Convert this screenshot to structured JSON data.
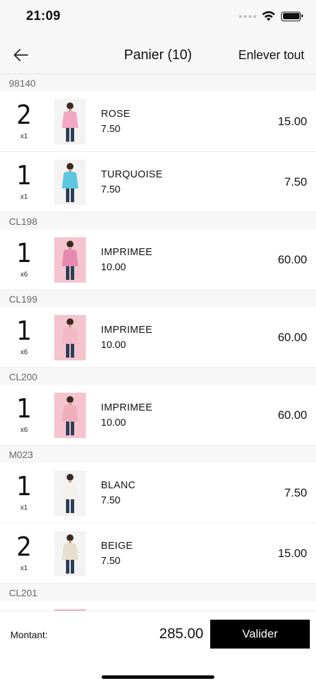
{
  "status": {
    "time": "21:09"
  },
  "nav": {
    "title": "Panier (10)",
    "remove_all": "Enlever tout"
  },
  "groups": [
    {
      "code": "98140",
      "items": [
        {
          "qty": "2",
          "mult": "x1",
          "name": "ROSE",
          "unit_price": "7.50",
          "total": "15.00",
          "color": "#f2a7c3"
        },
        {
          "qty": "1",
          "mult": "x1",
          "name": "TURQUOISE",
          "unit_price": "7.50",
          "total": "7.50",
          "color": "#5cc8df"
        }
      ]
    },
    {
      "code": "CL198",
      "items": [
        {
          "qty": "1",
          "mult": "x6",
          "name": "IMPRIMEE",
          "unit_price": "10.00",
          "total": "60.00",
          "color": "#e88ab0"
        }
      ]
    },
    {
      "code": "CL199",
      "items": [
        {
          "qty": "1",
          "mult": "x6",
          "name": "IMPRIMEE",
          "unit_price": "10.00",
          "total": "60.00",
          "color": "#f3b9c6"
        }
      ]
    },
    {
      "code": "CL200",
      "items": [
        {
          "qty": "1",
          "mult": "x6",
          "name": "IMPRIMEE",
          "unit_price": "10.00",
          "total": "60.00",
          "color": "#f0aebd"
        }
      ]
    },
    {
      "code": "M023",
      "items": [
        {
          "qty": "1",
          "mult": "x1",
          "name": "BLANC",
          "unit_price": "7.50",
          "total": "7.50",
          "color": "#f4f1ec"
        },
        {
          "qty": "2",
          "mult": "x1",
          "name": "BEIGE",
          "unit_price": "7.50",
          "total": "15.00",
          "color": "#e7dfcc"
        }
      ]
    },
    {
      "code": "CL201",
      "items": []
    }
  ],
  "footer": {
    "amount_label": "Montant:",
    "amount": "285.00",
    "validate_label": "Valider"
  }
}
